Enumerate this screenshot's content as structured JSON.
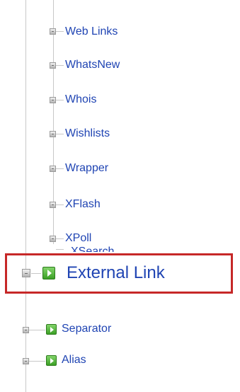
{
  "tree": {
    "items": [
      {
        "label": "Web Links"
      },
      {
        "label": "WhatsNew"
      },
      {
        "label": "Whois"
      },
      {
        "label": "Wishlists"
      },
      {
        "label": "Wrapper"
      },
      {
        "label": "XFlash"
      },
      {
        "label": "XPoll"
      }
    ],
    "cut_item": {
      "label": "XSearch"
    }
  },
  "menu_types": [
    {
      "label": "External Link",
      "highlighted": true
    },
    {
      "label": "Separator",
      "highlighted": false
    },
    {
      "label": "Alias",
      "highlighted": false
    }
  ],
  "colors": {
    "link": "#1f44b3",
    "highlight": "#c62828",
    "menu_type_icon": "#3b9f25"
  }
}
